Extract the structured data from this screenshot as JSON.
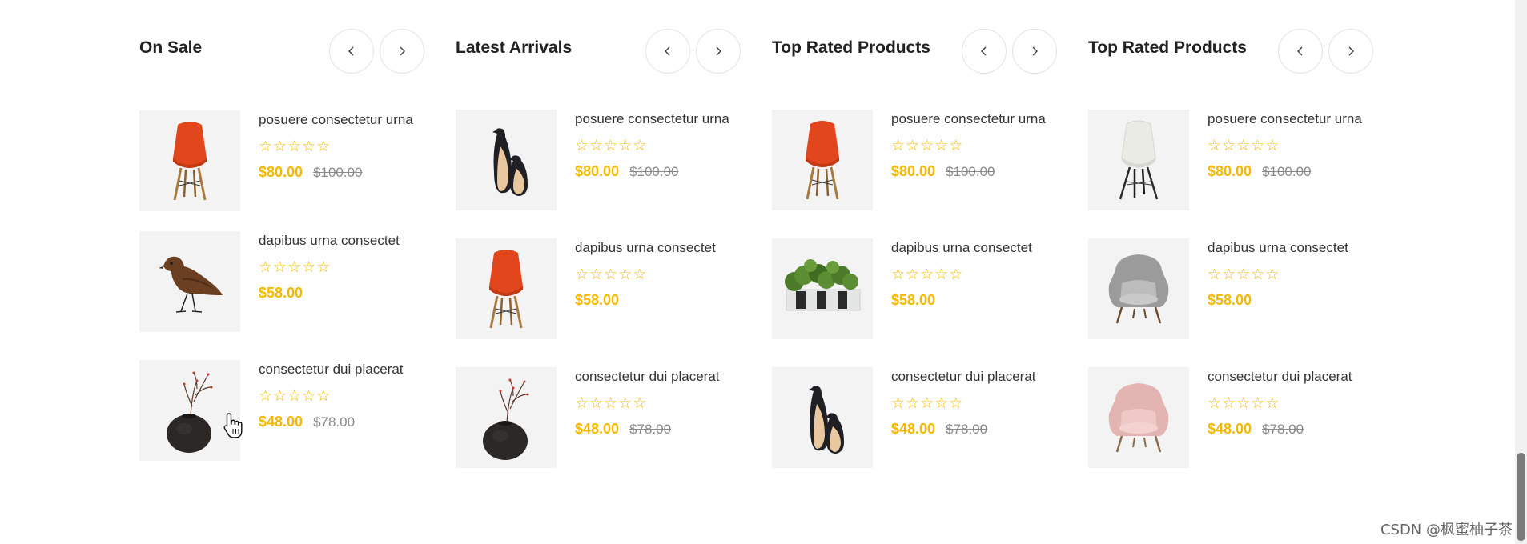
{
  "columns": [
    {
      "title": "On Sale",
      "products": [
        {
          "name": "posuere consectetur urna",
          "image": "orange-chair",
          "rating": 0,
          "price": "$80.00",
          "old_price": "$100.00"
        },
        {
          "name": "dapibus urna consectet",
          "image": "wooden-bird",
          "rating": 0,
          "price": "$58.00",
          "old_price": ""
        },
        {
          "name": "consectetur dui placerat",
          "image": "black-vase",
          "rating": 0,
          "price": "$48.00",
          "old_price": "$78.00"
        }
      ]
    },
    {
      "title": "Latest Arrivals",
      "products": [
        {
          "name": "posuere consectetur urna",
          "image": "penguins",
          "rating": 0,
          "price": "$80.00",
          "old_price": "$100.00"
        },
        {
          "name": "dapibus urna consectet",
          "image": "orange-chair",
          "rating": 0,
          "price": "$58.00",
          "old_price": ""
        },
        {
          "name": "consectetur dui placerat",
          "image": "black-vase",
          "rating": 0,
          "price": "$48.00",
          "old_price": "$78.00"
        }
      ]
    },
    {
      "title": "Top Rated Products",
      "products": [
        {
          "name": "posuere consectetur urna",
          "image": "orange-chair",
          "rating": 0,
          "price": "$80.00",
          "old_price": "$100.00"
        },
        {
          "name": "dapibus urna consectet",
          "image": "plants",
          "rating": 0,
          "price": "$58.00",
          "old_price": ""
        },
        {
          "name": "consectetur dui placerat",
          "image": "penguins",
          "rating": 0,
          "price": "$48.00",
          "old_price": "$78.00"
        }
      ]
    },
    {
      "title": "Top Rated Products",
      "products": [
        {
          "name": "posuere consectetur urna",
          "image": "white-chair",
          "rating": 0,
          "price": "$80.00",
          "old_price": "$100.00"
        },
        {
          "name": "dapibus urna consectet",
          "image": "grey-armchair",
          "rating": 0,
          "price": "$58.00",
          "old_price": ""
        },
        {
          "name": "consectetur dui placerat",
          "image": "pink-armchair",
          "rating": 0,
          "price": "$48.00",
          "old_price": "$78.00"
        }
      ]
    }
  ],
  "nav_icons": {
    "prev": "chevron-left-icon",
    "next": "chevron-right-icon"
  },
  "rating_icon": "star-outline-icon",
  "cursor_icon": "hand-pointer-icon",
  "colors": {
    "accent": "#f5b800",
    "old_price": "#8a8a8a",
    "thumb_bg": "#f3f3f3",
    "border": "#e3e3e3"
  },
  "watermark": "CSDN @枫蜜柚子茶"
}
